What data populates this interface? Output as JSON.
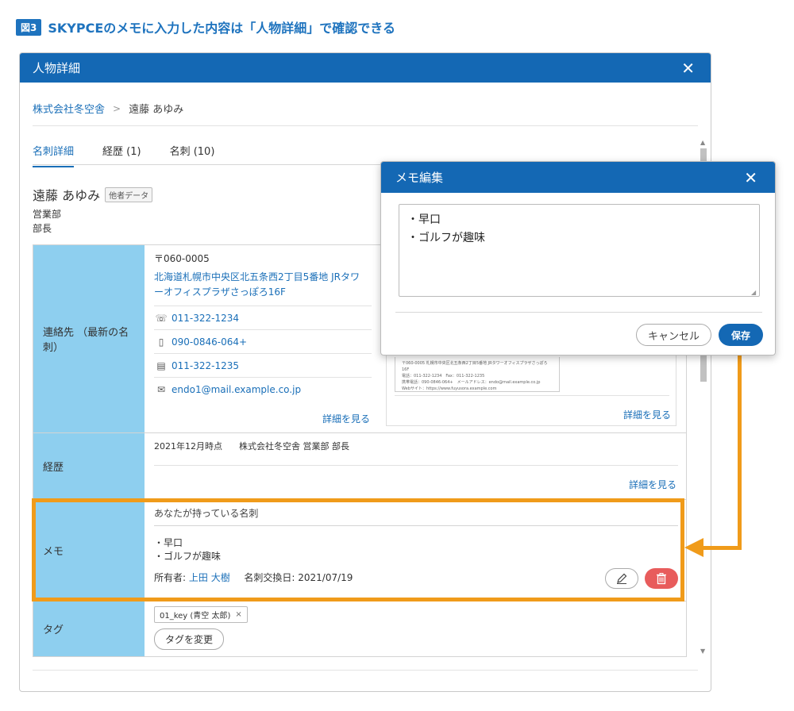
{
  "figure": {
    "badge": "図3",
    "title": "SKYPCEのメモに入力した内容は「人物詳細」で確認できる"
  },
  "main": {
    "title": "人物詳細",
    "breadcrumb": {
      "company": "株式会社冬空舎",
      "separator": ">",
      "person": "遠藤 あゆみ"
    },
    "tabs": [
      {
        "label": "名刺詳細"
      },
      {
        "label": "経歴 (1)"
      },
      {
        "label": "名刺 (10)"
      }
    ],
    "person": {
      "name": "遠藤 あゆみ",
      "badge": "他者データ",
      "department": "営業部",
      "role": "部長"
    },
    "contact": {
      "label": "連絡先 （最新の名刺）",
      "zip": "〒060-0005",
      "address": "北海道札幌市中央区北五条西2丁目5番地 JRタワーオフィスプラザさっぽろ16F",
      "phone": "011-322-1234",
      "mobile": "090-0846-064+",
      "fax": "011-322-1235",
      "email": "endo1@mail.example.co.jp",
      "more_link": "詳細を見る",
      "card_more_link": "詳細を見る",
      "card_text": [
        "〒060-0005 札幌市中央区北五条西2丁目5番地 JRタワーオフィスプラザさっぽろ16F",
        "電話：011-322-1234　Fax：011-322-1235",
        "携帯電話：090-0846-064+　メールアドレス：endo@mail.example.co.jp",
        "Webサイト：https://www.fuyusora.example.com"
      ]
    },
    "career": {
      "label": "経歴",
      "date": "2021年12月時点",
      "entry": "株式会社冬空舎 営業部 部長",
      "more_link": "詳細を見る"
    },
    "memo": {
      "label": "メモ",
      "title": "あなたが持っている名刺",
      "line1": "・早口",
      "line2": "・ゴルフが趣味",
      "owner_label": "所有者:",
      "owner_name": "上田 大樹",
      "exchange_label": "名刺交換日:",
      "exchange_date": "2021/07/19"
    },
    "tag": {
      "label": "タグ",
      "chip": "01_key (青空 太郎)",
      "change_button": "タグを変更"
    }
  },
  "popup": {
    "title": "メモ編集",
    "text": "・早口\n・ゴルフが趣味",
    "cancel": "キャンセル",
    "save": "保存"
  },
  "colors": {
    "header_blue": "#1468b4",
    "label_bg": "#8ecfef",
    "highlight": "#f09b1a",
    "delete_red": "#e85c5c",
    "link": "#1a6fb8"
  }
}
